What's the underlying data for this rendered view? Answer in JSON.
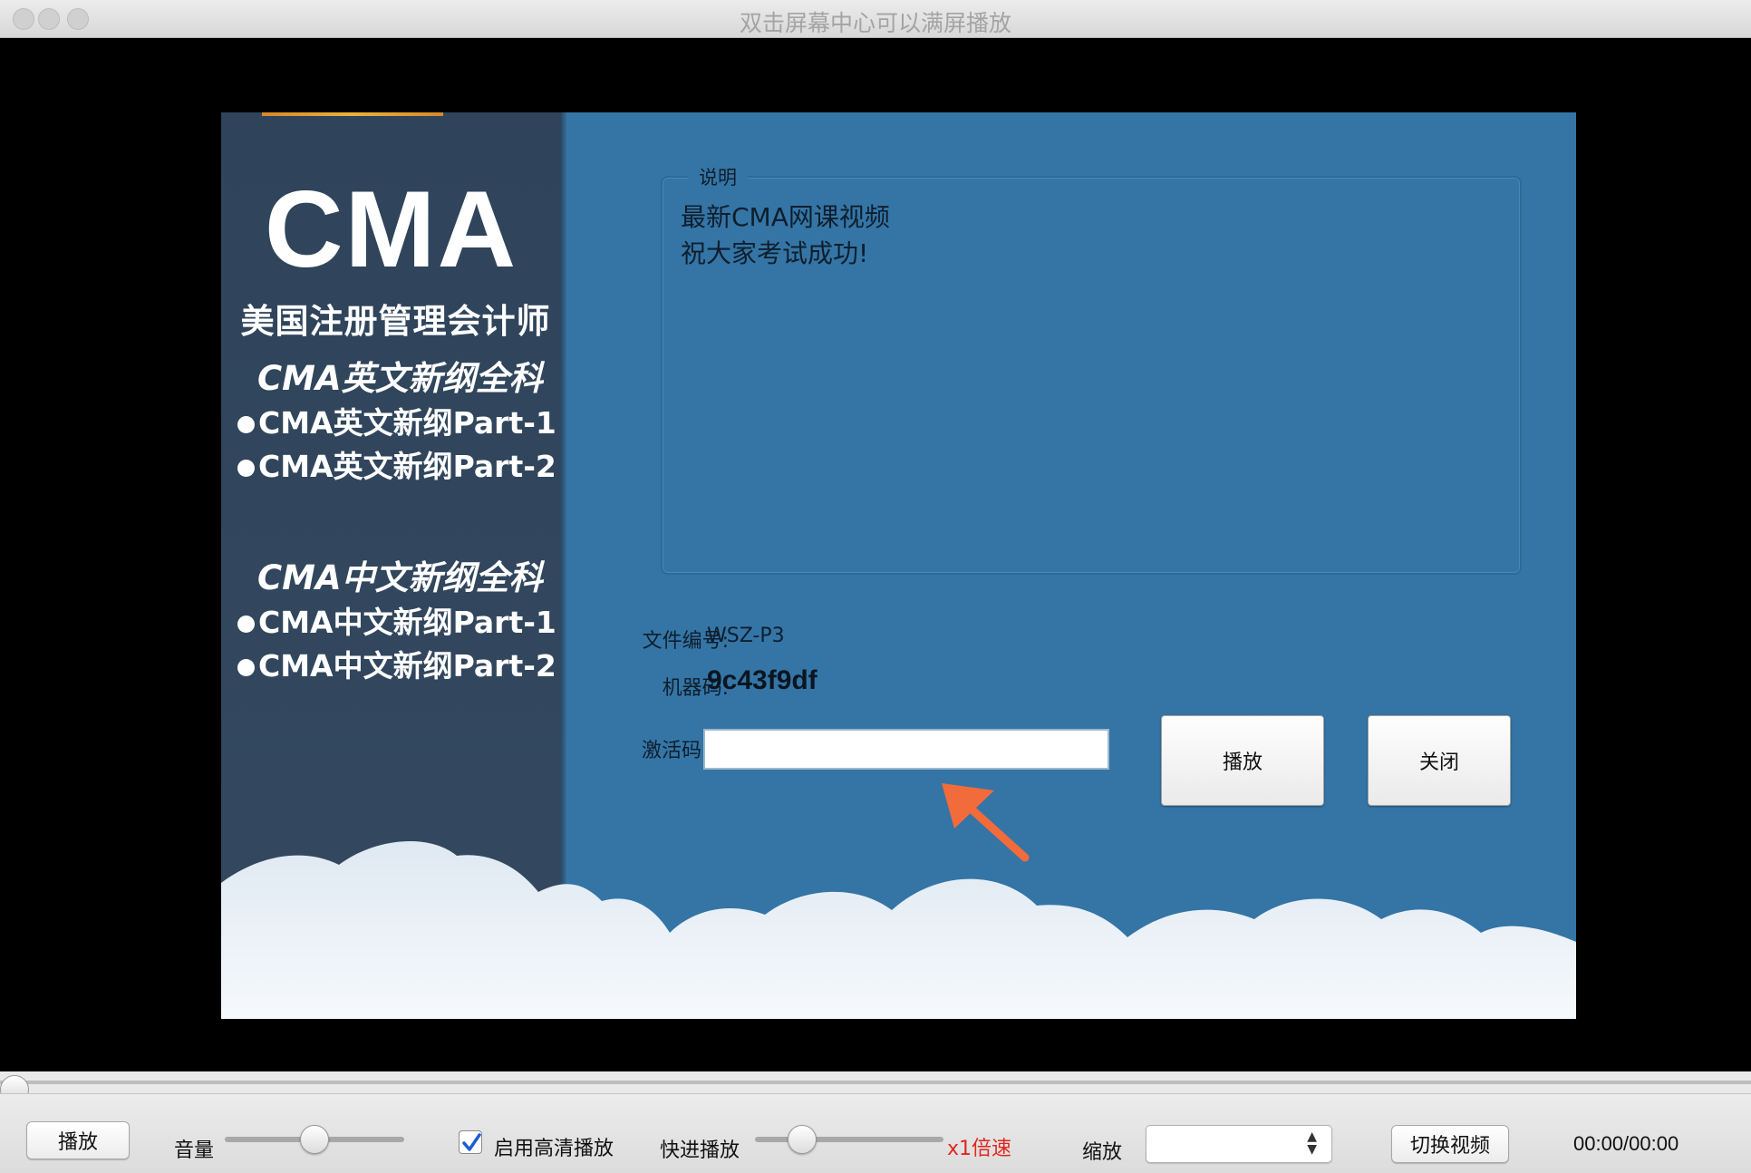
{
  "window": {
    "title": "双击屏幕中心可以满屏播放"
  },
  "video": {
    "left_panel": {
      "logo": "CMA",
      "subtitle": "美国注册管理会计师",
      "english_heading": "CMA英文新纲全科",
      "english_items": [
        "CMA英文新纲Part-1",
        "CMA英文新纲Part-2"
      ],
      "chinese_heading": "CMA中文新纲全科",
      "chinese_items": [
        "CMA中文新纲Part-1",
        "CMA中文新纲Part-2"
      ]
    },
    "description": {
      "legend": "说明",
      "lines": [
        "最新CMA网课视频",
        "祝大家考试成功!"
      ]
    },
    "file_no_label": "文件编号:",
    "file_no_value": "WSZ-P3",
    "machine_code_label": "机器码:",
    "machine_code_value": "9c43f9df",
    "activation_label": "激活码",
    "activation_value": "",
    "play_button": "播放",
    "close_button": "关闭",
    "colors": {
      "panel_bg": "#3475a6",
      "left_bg": "#2f445b",
      "arrow": "#f26b3a"
    }
  },
  "controls": {
    "play_button": "播放",
    "volume_label": "音量",
    "volume_level": 0.5,
    "progress": 0,
    "hd_checkbox_label": "启用高清播放",
    "hd_checked": true,
    "fast_forward_label": "快进播放",
    "speed_level": 0.25,
    "speed_text": "x1倍速",
    "zoom_label": "缩放",
    "zoom_value": "",
    "switch_video_button": "切换视频",
    "time": "00:00/00:00"
  }
}
